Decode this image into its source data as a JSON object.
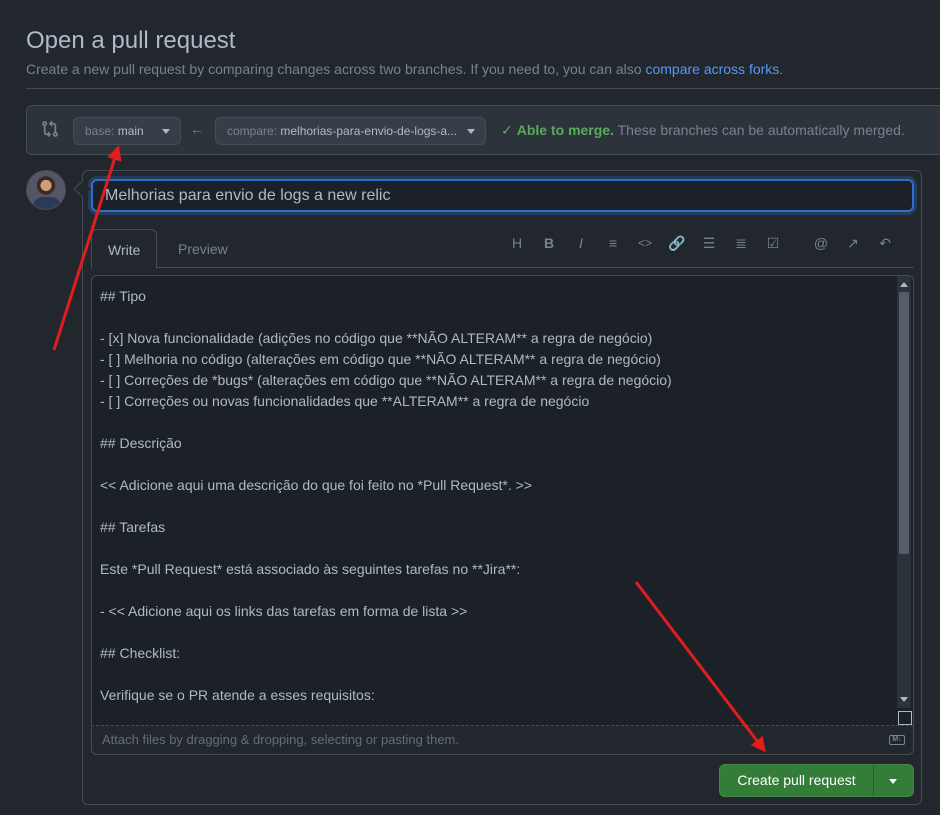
{
  "header": {
    "title": "Open a pull request",
    "subtitle": "Create a new pull request by comparing changes across two branches. If you need to, you can also ",
    "subtitle_link": "compare across forks",
    "subtitle_end": "."
  },
  "range": {
    "base_prefix": "base: ",
    "base_branch": "main",
    "compare_prefix": "compare: ",
    "compare_branch": "melhorias-para-envio-de-logs-a...",
    "merge_ok": "Able to merge.",
    "merge_text": " These branches can be automatically merged."
  },
  "composer": {
    "title_value": "Melhorias para envio de logs a new relic",
    "tabs": [
      "Write",
      "Preview"
    ],
    "toolbar": [
      {
        "icon": "heading-icon",
        "glyph": "H"
      },
      {
        "icon": "bold-icon",
        "glyph": "B"
      },
      {
        "icon": "italic-icon",
        "glyph": "I"
      },
      {
        "icon": "quote-icon",
        "glyph": "≡"
      },
      {
        "icon": "code-icon",
        "glyph": "<>"
      },
      {
        "icon": "link-icon",
        "glyph": "🔗"
      },
      {
        "icon": "unordered-list-icon",
        "glyph": "☰"
      },
      {
        "icon": "ordered-list-icon",
        "glyph": "≣"
      },
      {
        "icon": "task-list-icon",
        "glyph": "☑"
      },
      {
        "icon": "mention-icon",
        "glyph": "@"
      },
      {
        "icon": "cross-reference-icon",
        "glyph": "↗"
      },
      {
        "icon": "reply-icon",
        "glyph": "↶"
      }
    ],
    "body_lines": [
      "## Tipo",
      "",
      "- [x] Nova funcionalidade (adições no código que **NÃO ALTERAM** a regra de negócio)",
      "- [ ] Melhoria no código (alterações em código que **NÃO ALTERAM** a regra de negócio)",
      "- [ ] Correções de *bugs* (alterações em código que **NÃO ALTERAM** a regra de negócio)",
      "- [ ] Correções ou novas funcionalidades que **ALTERAM** a regra de negócio",
      "",
      "## Descrição",
      "",
      "<< Adicione aqui uma descrição do que foi feito no *Pull Request*. >>",
      "",
      "## Tarefas",
      "",
      "Este *Pull Request* está associado às seguintes tarefas no **Jira**:",
      "",
      "- << Adicione aqui os links das tarefas em forma de lista >>",
      "",
      "## Checklist:",
      "",
      "Verifique se o PR atende a esses requisitos:"
    ],
    "attach_hint": "Attach files by dragging & dropping, selecting or pasting them.",
    "markdown_badge": "M↓",
    "submit_label": "Create pull request"
  },
  "colors": {
    "background": "#22272e",
    "accent": "#316dca",
    "success": "#57ab5a",
    "primary_button": "#347d39",
    "annotation_arrow": "#e01e1e"
  }
}
